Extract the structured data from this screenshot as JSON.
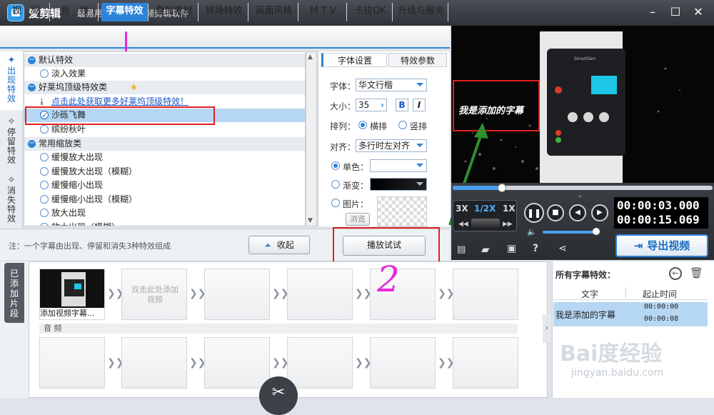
{
  "app": {
    "title": "爱剪辑",
    "subtitle": "最易用、强大的视频剪辑软件"
  },
  "tabs": [
    "视　频",
    "音　频",
    "字幕特效",
    "叠加素材",
    "转场特效",
    "画面风格",
    "M T V",
    "卡拉OK",
    "升级与服务"
  ],
  "sidebar": [
    "出现特效",
    "停留特效",
    "消失特效"
  ],
  "effects": [
    {
      "type": "cat",
      "label": "默认特效"
    },
    {
      "type": "item",
      "label": "淡入效果"
    },
    {
      "type": "cat",
      "label": "好莱坞顶级特效类"
    },
    {
      "type": "link",
      "label": "点击此处获取更多好莱坞顶级特效！"
    },
    {
      "type": "item",
      "label": "沙砾飞舞",
      "selected": true
    },
    {
      "type": "item",
      "label": "缤纷秋叶"
    },
    {
      "type": "cat",
      "label": "常用缩放类"
    },
    {
      "type": "item",
      "label": "缓慢放大出现"
    },
    {
      "type": "item",
      "label": "缓慢放大出现（模糊）"
    },
    {
      "type": "item",
      "label": "缓慢缩小出现"
    },
    {
      "type": "item",
      "label": "缓慢缩小出现（模糊）"
    },
    {
      "type": "item",
      "label": "放大出现"
    },
    {
      "type": "item",
      "label": "放大出现（模糊）"
    }
  ],
  "props": {
    "tab_font": "字体设置",
    "tab_effect": "特效参数",
    "font_label": "字体：",
    "font_value": "华文行楷",
    "size_label": "大小：",
    "size_value": "35",
    "bold": "B",
    "italic": "I",
    "layout_label": "排列：",
    "horizontal": "横排",
    "vertical": "竖排",
    "align_label": "对齐：",
    "align_value": "多行时左对齐",
    "solid": "单色：",
    "gradient": "渐变：",
    "image": "图片：",
    "browse": "浏览"
  },
  "hint": "注：一个字幕由出现、停留和消失3种特效组成",
  "collapse_button": "收起",
  "play_test_button": "播放试试",
  "preview": {
    "caption": "我是添加的字幕",
    "device_brand": "SmartGen"
  },
  "controls": {
    "speed_3x": "3X",
    "speed_half": "1/2X",
    "speed_1x": "1X",
    "time_current": "00:00:03.000",
    "time_total": "00:00:15.069",
    "progress": 0.19
  },
  "export_button": "导出视频",
  "track": {
    "added_tab": "已添加片段",
    "clip1_label": "添加视频字幕...",
    "empty_clip_hint": "双击此处添加视频",
    "audio_label": "音 频"
  },
  "subtitle_panel": {
    "title": "所有字幕特效：",
    "col_text": "文字",
    "col_time": "起止时间",
    "row_text": "我是添加的字幕",
    "row_start": "00:00:00",
    "row_end": "00:00:08"
  },
  "annotation": {
    "number": "2"
  },
  "watermark": {
    "brand": "Bai度经验",
    "url": "jingyan.baidu.com"
  }
}
